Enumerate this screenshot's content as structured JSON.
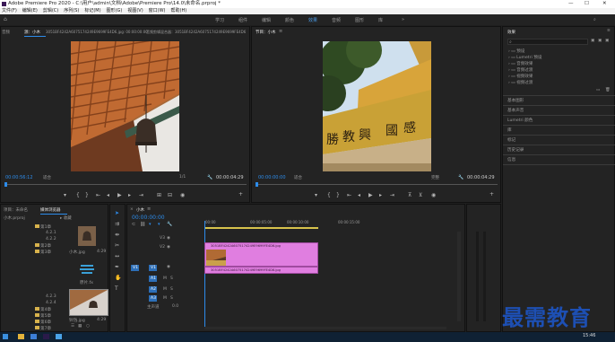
{
  "window": {
    "title": "Adobe Premiere Pro 2020 - C:\\用户\\admin\\文档\\Adobe\\Premiere Pro\\14.0\\未命名.prproj *"
  },
  "menu": [
    "文件(F)",
    "编辑(E)",
    "剪辑(C)",
    "序列(S)",
    "标记(M)",
    "图形(G)",
    "视图(V)",
    "窗口(W)",
    "帮助(H)"
  ],
  "workspaces": [
    "学习",
    "组件",
    "编辑",
    "颜色",
    "效果",
    "音频",
    "图形",
    "库"
  ],
  "active_workspace": "效果",
  "source": {
    "tabs": [
      "源：小木",
      "3051BF4242A6075174249E9699FE4D6.jpg: 00:00:00:00",
      "音频剪辑混合器：3051BF4242A6075174249E9699FE4D6"
    ],
    "tab_left": "音频",
    "timecode_left": "00:00:56:12",
    "zoom": "适合",
    "ratio": "1/1",
    "timecode_right": "00:00:04:29"
  },
  "program": {
    "tab": "节目：小木",
    "timecode_left": "00:00:00:00",
    "zoom": "适合",
    "ratio": "完整",
    "timecode_right": "00:00:04:29"
  },
  "effects": {
    "title": "效果",
    "items": [
      "预设",
      "Lumetri 预设",
      "音频效果",
      "音频过渡",
      "视频效果",
      "视频过渡"
    ],
    "sections": [
      "基本图形",
      "基本声音",
      "Lumetri 颜色",
      "库",
      "标记",
      "历史记录",
      "信息"
    ]
  },
  "project": {
    "tabs": [
      "项目：未命名",
      "媒体浏览器"
    ],
    "project_name": "小木.prproj",
    "folder_label": "收藏",
    "tree": [
      "第1章",
      "4.2.1",
      "4.2.2",
      "第2章",
      "第3章",
      "4.2.3",
      "4.2.4",
      "第4章",
      "第5章",
      "第6章",
      "第7章",
      "第8章",
      "第9章",
      "第10章",
      "第11章"
    ],
    "clips": [
      {
        "name": "小木.jpg",
        "duration": "4:29"
      },
      {
        "name": "原片.fx",
        "duration": ""
      },
      {
        "name": "铃铛.jpg",
        "duration": "4:29"
      }
    ]
  },
  "timeline": {
    "tab": "小木",
    "timecode": "00:00:00:00",
    "ruler": [
      "00:00",
      "00:00:05:00",
      "00:00:10:00",
      "00:00:15:00"
    ],
    "tracks_video": [
      "V3",
      "V2",
      "V1"
    ],
    "tracks_audio": [
      "A1",
      "A2",
      "A3"
    ],
    "master": "主声道",
    "master_value": "0.0",
    "clip_top": "3051BF4242A6075174249E9699FE4D6.jpg",
    "clip_bottom": "3051BF4242A6075174249E9699FE4D6.jpg"
  },
  "watermark": "最需教育",
  "clock": "15:46",
  "colors": {
    "accent": "#2d8ceb",
    "clip": "#e07ee0",
    "workarea": "#d7c24c"
  }
}
